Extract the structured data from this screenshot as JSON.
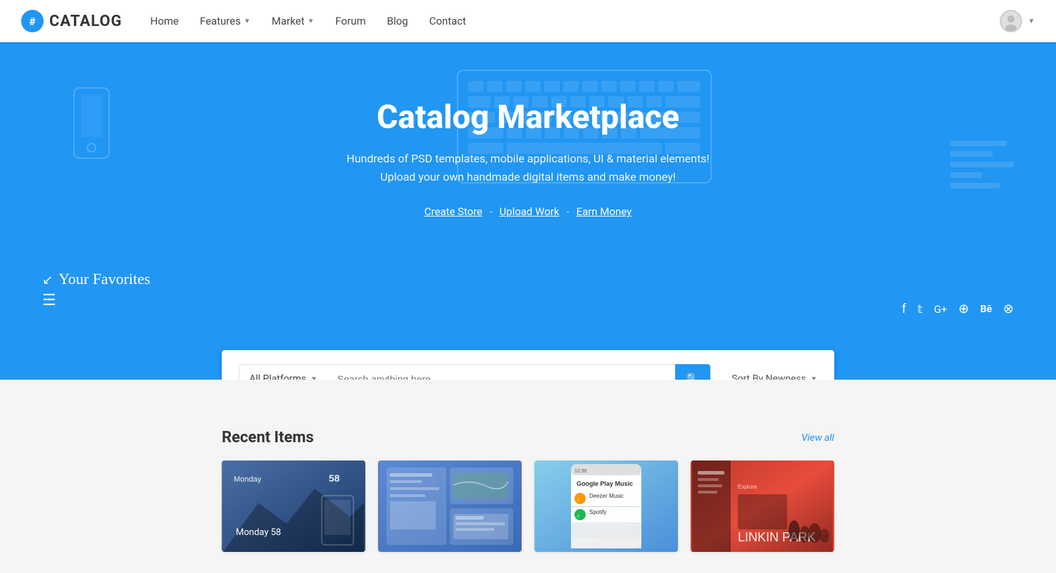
{
  "brand": {
    "icon": "#",
    "name": "CATALOG"
  },
  "nav": {
    "links": [
      {
        "label": "Home",
        "hasDropdown": false
      },
      {
        "label": "Features",
        "hasDropdown": true
      },
      {
        "label": "Market",
        "hasDropdown": true
      },
      {
        "label": "Forum",
        "hasDropdown": false
      },
      {
        "label": "Blog",
        "hasDropdown": false
      },
      {
        "label": "Contact",
        "hasDropdown": false
      }
    ]
  },
  "hero": {
    "title": "Catalog Marketplace",
    "subtitle": "Hundreds of PSD templates, mobile applications, UI & material elements! Upload your own handmade digital items and make money!",
    "links": [
      {
        "label": "Create Store"
      },
      {
        "label": "Upload Work"
      },
      {
        "label": "Earn Money"
      }
    ],
    "favorites_text": "Your Favorites"
  },
  "search": {
    "platform_label": "All Platforms",
    "placeholder": "Search anything here.",
    "sort_label": "Sort By Newness"
  },
  "social": {
    "icons": [
      "f",
      "t",
      "g+",
      "⊕",
      "Be",
      "⊗"
    ]
  },
  "recent": {
    "section_title": "Recent Items",
    "view_all_label": "View all"
  },
  "colors": {
    "primary": "#2196F3",
    "brand_dark": "#333"
  }
}
